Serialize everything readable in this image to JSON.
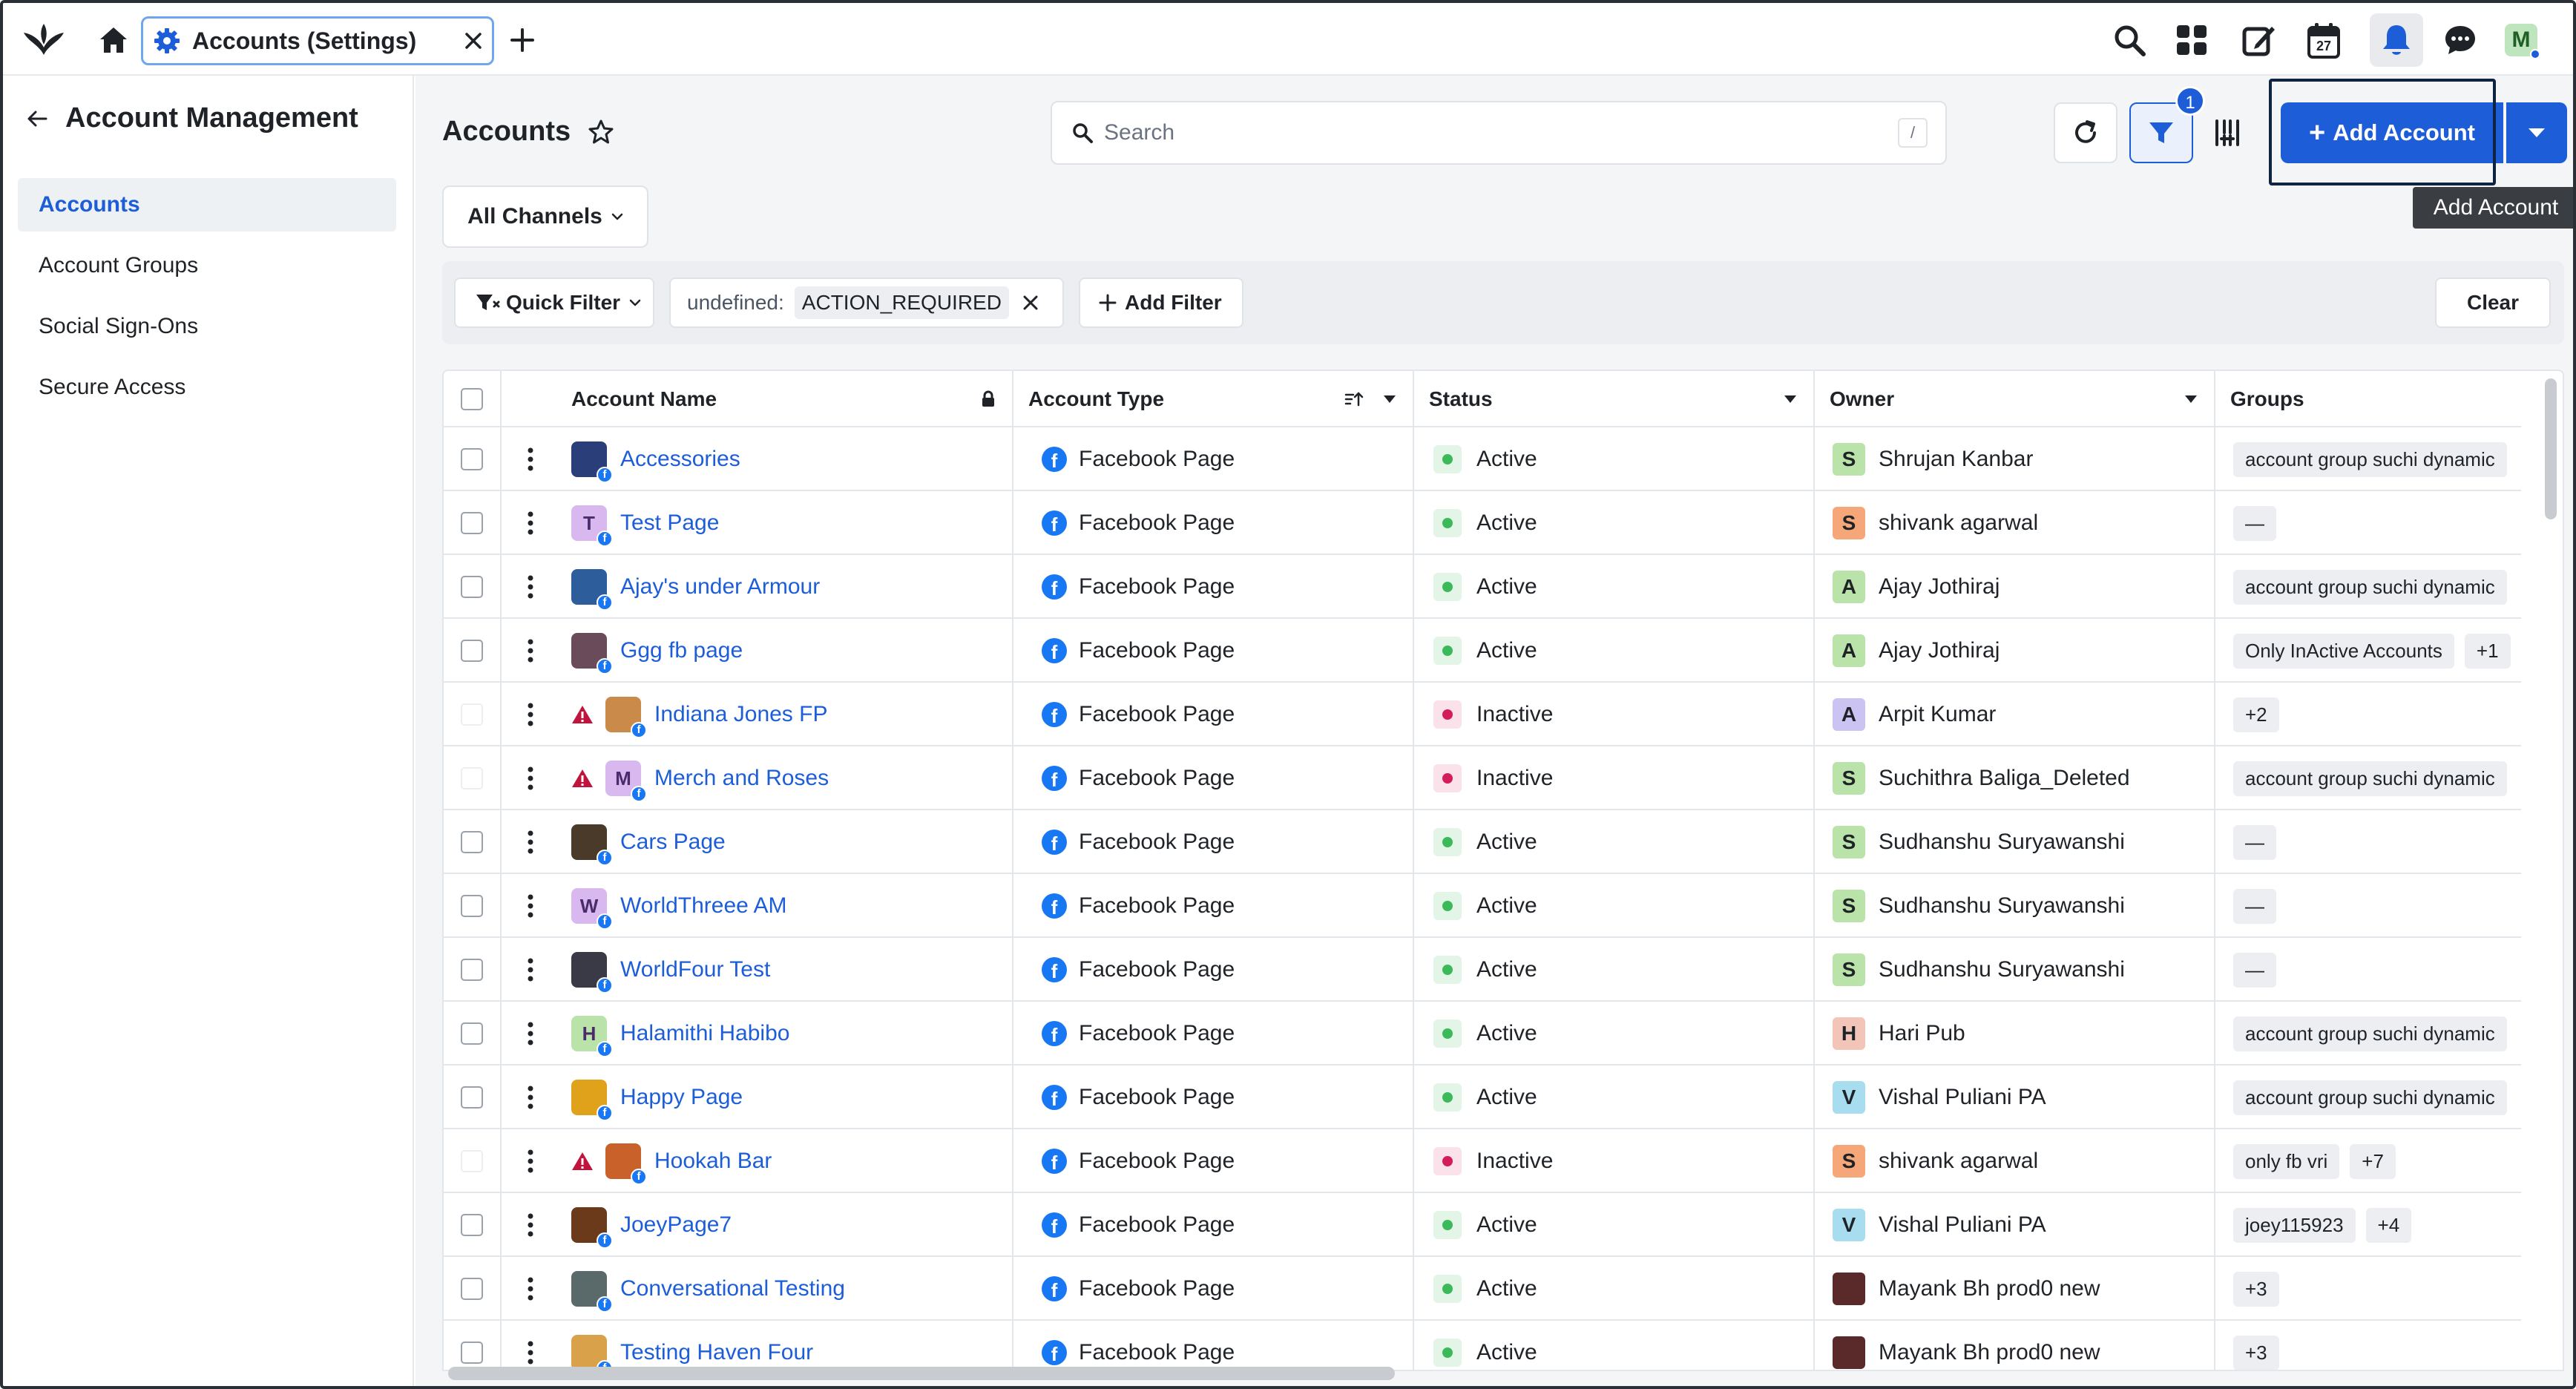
{
  "topbar": {
    "tab_label": "Accounts (Settings)",
    "icons": [
      "logo-icon",
      "home-icon",
      "gear-icon",
      "close-icon",
      "plus-icon",
      "search-icon",
      "apps-grid-icon",
      "compose-icon",
      "calendar-icon",
      "bell-icon",
      "chat-icon"
    ],
    "calendar_day": "27",
    "user_initial": "M"
  },
  "sidebar": {
    "title": "Account Management",
    "items": [
      {
        "label": "Accounts",
        "active": true
      },
      {
        "label": "Account Groups",
        "active": false
      },
      {
        "label": "Social Sign-Ons",
        "active": false
      },
      {
        "label": "Secure Access",
        "active": false
      }
    ]
  },
  "header": {
    "title": "Accounts",
    "search_placeholder": "Search",
    "search_shortcut": "/",
    "filter_count": "1",
    "add_label": "Add Account",
    "tooltip": "Add Account",
    "channels_label": "All Channels"
  },
  "filters": {
    "quick_filter": "Quick Filter",
    "applied_key": "undefined:",
    "applied_value": "ACTION_REQUIRED",
    "add_filter": "Add Filter",
    "clear": "Clear"
  },
  "table": {
    "columns": [
      "Account Name",
      "Account Type",
      "Status",
      "Owner",
      "Groups"
    ],
    "rows": [
      {
        "name": "Accessories",
        "warn": false,
        "avatar": "",
        "avatar_bg": "#2a3f7a",
        "type": "Facebook Page",
        "status": "Active",
        "owner_initial": "S",
        "owner_bg": "#b9e3a8",
        "owner": "Shrujan Kanbar",
        "groups": [
          "account group suchi dynamic"
        ]
      },
      {
        "name": "Test Page",
        "warn": false,
        "avatar": "T",
        "avatar_bg": "#d9b8ef",
        "type": "Facebook Page",
        "status": "Active",
        "owner_initial": "S",
        "owner_bg": "#f6a77a",
        "owner": "shivank agarwal",
        "groups": [
          "—"
        ]
      },
      {
        "name": "Ajay's under Armour",
        "warn": false,
        "avatar": "",
        "avatar_bg": "#2d5d9a",
        "type": "Facebook Page",
        "status": "Active",
        "owner_initial": "A",
        "owner_bg": "#b9e3a8",
        "owner": "Ajay Jothiraj",
        "groups": [
          "account group suchi dynamic"
        ]
      },
      {
        "name": "Ggg fb page",
        "warn": false,
        "avatar": "",
        "avatar_bg": "#6a4b5a",
        "type": "Facebook Page",
        "status": "Active",
        "owner_initial": "A",
        "owner_bg": "#b9e3a8",
        "owner": "Ajay Jothiraj",
        "groups": [
          "Only InActive Accounts",
          "+1"
        ]
      },
      {
        "name": "Indiana Jones FP",
        "warn": true,
        "avatar": "",
        "avatar_bg": "#c98a4a",
        "type": "Facebook Page",
        "status": "Inactive",
        "owner_initial": "A",
        "owner_bg": "#cbc3f2",
        "owner": "Arpit Kumar",
        "groups": [
          "+2"
        ]
      },
      {
        "name": "Merch and Roses",
        "warn": true,
        "avatar": "M",
        "avatar_bg": "#d9b8ef",
        "type": "Facebook Page",
        "status": "Inactive",
        "owner_initial": "S",
        "owner_bg": "#b9e3a8",
        "owner": "Suchithra Baliga_Deleted",
        "groups": [
          "account group suchi dynamic"
        ]
      },
      {
        "name": "Cars Page",
        "warn": false,
        "avatar": "",
        "avatar_bg": "#4a3a2a",
        "type": "Facebook Page",
        "status": "Active",
        "owner_initial": "S",
        "owner_bg": "#b9e3a8",
        "owner": "Sudhanshu Suryawanshi",
        "groups": [
          "—"
        ]
      },
      {
        "name": "WorldThreee AM",
        "warn": false,
        "avatar": "W",
        "avatar_bg": "#d9b8ef",
        "type": "Facebook Page",
        "status": "Active",
        "owner_initial": "S",
        "owner_bg": "#b9e3a8",
        "owner": "Sudhanshu Suryawanshi",
        "groups": [
          "—"
        ]
      },
      {
        "name": "WorldFour Test",
        "warn": false,
        "avatar": "",
        "avatar_bg": "#3a3a46",
        "type": "Facebook Page",
        "status": "Active",
        "owner_initial": "S",
        "owner_bg": "#b9e3a8",
        "owner": "Sudhanshu Suryawanshi",
        "groups": [
          "—"
        ]
      },
      {
        "name": "Halamithi Habibo",
        "warn": false,
        "avatar": "H",
        "avatar_bg": "#b9e3a8",
        "type": "Facebook Page",
        "status": "Active",
        "owner_initial": "H",
        "owner_bg": "#f3c4b8",
        "owner": "Hari Pub",
        "groups": [
          "account group suchi dynamic"
        ]
      },
      {
        "name": "Happy Page",
        "warn": false,
        "avatar": "",
        "avatar_bg": "#e0a21a",
        "type": "Facebook Page",
        "status": "Active",
        "owner_initial": "V",
        "owner_bg": "#a8dcef",
        "owner": "Vishal Puliani PA",
        "groups": [
          "account group suchi dynamic"
        ]
      },
      {
        "name": "Hookah Bar",
        "warn": true,
        "avatar": "",
        "avatar_bg": "#c9622a",
        "type": "Facebook Page",
        "status": "Inactive",
        "owner_initial": "S",
        "owner_bg": "#f6a77a",
        "owner": "shivank agarwal",
        "groups": [
          "only fb vri",
          "+7"
        ]
      },
      {
        "name": "JoeyPage7",
        "warn": false,
        "avatar": "",
        "avatar_bg": "#6a3a1a",
        "type": "Facebook Page",
        "status": "Active",
        "owner_initial": "V",
        "owner_bg": "#a8dcef",
        "owner": "Vishal Puliani PA",
        "groups": [
          "joey115923",
          "+4"
        ]
      },
      {
        "name": "Conversational Testing",
        "warn": false,
        "avatar": "",
        "avatar_bg": "#5a6a6a",
        "type": "Facebook Page",
        "status": "Active",
        "owner_initial": "",
        "owner_bg": "#5a2a2a",
        "owner": "Mayank Bh prod0 new",
        "groups": [
          "+3"
        ]
      },
      {
        "name": "Testing Haven Four",
        "warn": false,
        "avatar": "",
        "avatar_bg": "#d9a24a",
        "type": "Facebook Page",
        "status": "Active",
        "owner_initial": "",
        "owner_bg": "#5a2a2a",
        "owner": "Mayank Bh prod0 new",
        "groups": [
          "+3"
        ]
      }
    ]
  },
  "colors": {
    "accent": "#1d5ed8",
    "active_dot": "#3cb95b",
    "active_bg": "#e3f5e6",
    "inactive_dot": "#d21c5b",
    "inactive_bg": "#fbe1ea",
    "warn": "#c0143c"
  }
}
